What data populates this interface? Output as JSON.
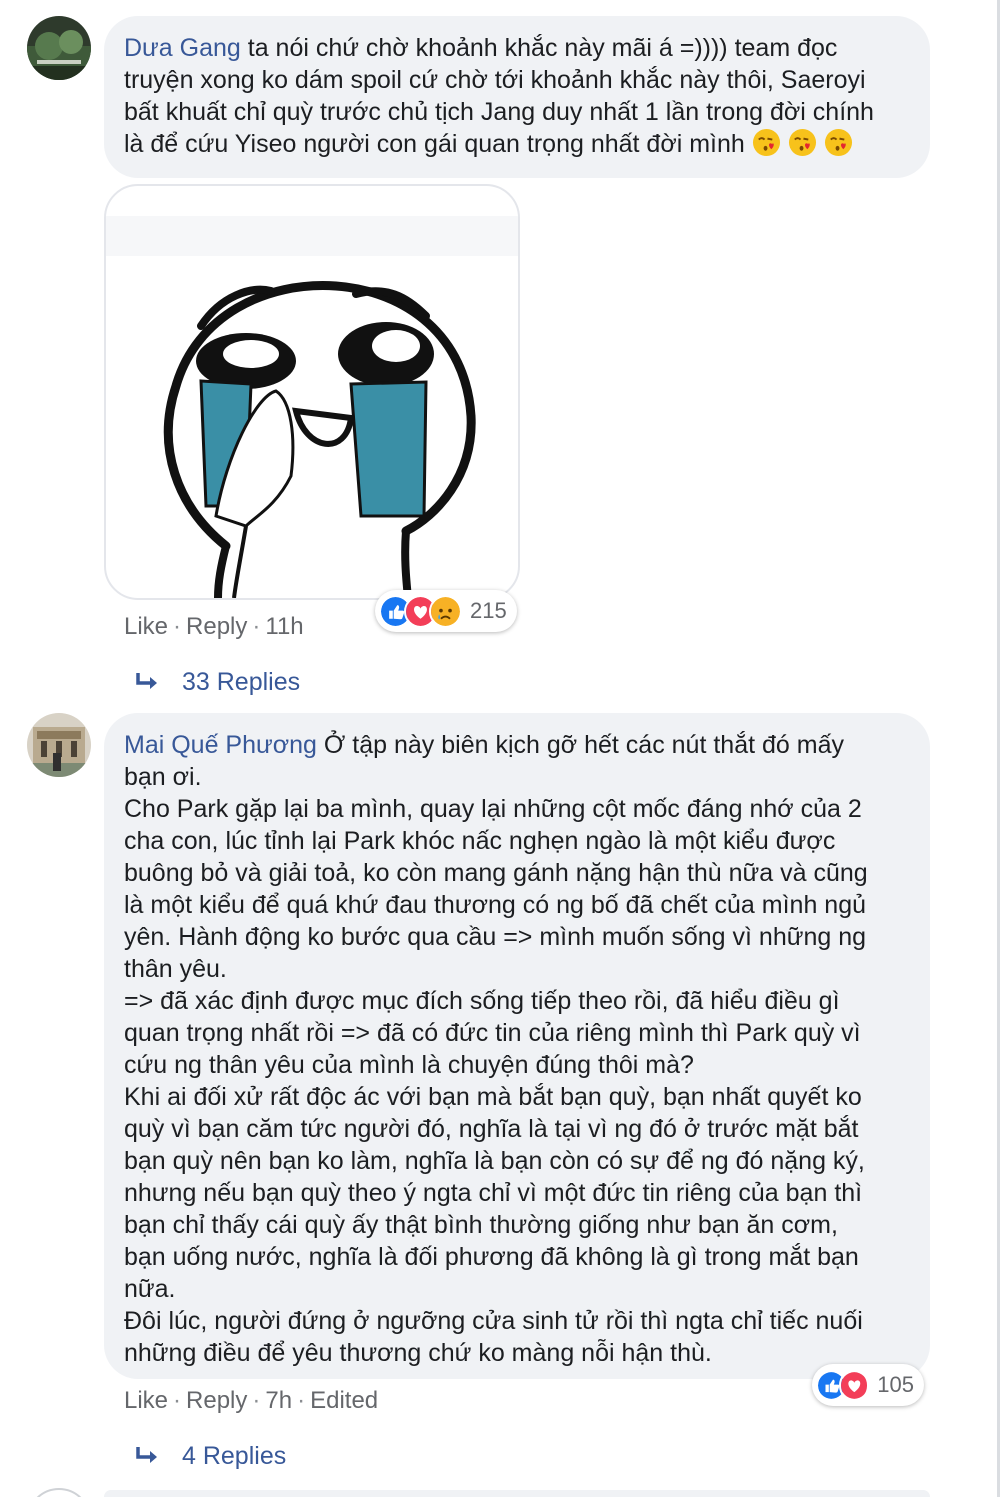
{
  "comments": [
    {
      "author": "Dưa Gang",
      "text": " ta nói chứ chờ khoảnh khắc này mãi á =)))) team đọc\ntruyện xong ko dám spoil cứ chờ tới khoảnh khắc này thôi, Saeroyi\nbất khuất chỉ quỳ trước chủ tịch Jang duy nhất 1 lần trong đời chính\nlà để cứu Yiseo người con gái quan trọng nhất đời mình ",
      "emoji": [
        "kissing-heart",
        "kissing-heart",
        "kissing-heart"
      ],
      "has_sticker": true,
      "like_label": "Like",
      "reply_label": "Reply",
      "time": "11h",
      "reactions": [
        "like",
        "love",
        "sad"
      ],
      "reaction_count": "215",
      "replies_label": "33 Replies"
    },
    {
      "author": "Mai Quế Phương",
      "text": " Ở tập này biên kịch gỡ hết các nút thắt đó mấy\nbạn ơi.\nCho Park gặp lại ba mình, quay lại những cột mốc đáng nhớ của 2\ncha con, lúc tỉnh lại Park khóc nấc nghẹn ngào là một kiểu được\nbuông bỏ và giải toả, ko còn mang gánh nặng hận thù nữa và cũng\nlà một kiểu để quá khứ đau thương có ng bố đã chết của mình ngủ\nyên. Hành động ko bước qua cầu => mình muốn sống vì những ng\nthân yêu.\n=> đã xác định được mục đích sống tiếp theo rồi, đã hiểu điều gì\nquan trọng nhất rồi => đã có đức tin của riêng mình thì Park quỳ vì\ncứu ng thân yêu của mình là chuyện đúng thôi mà?\nKhi ai đối xử rất độc ác với bạn mà bắt bạn quỳ, bạn nhất quyết ko\nquỳ vì bạn căm tức người đó, nghĩa là tại vì ng đó ở trước mặt bắt\nbạn quỳ nên bạn ko làm, nghĩa là bạn còn có sự để ng đó nặng ký,\nnhưng nếu bạn quỳ theo ý ngta chỉ vì một đức tin riêng của bạn thì\nbạn chỉ thấy cái quỳ ấy thật bình thường giống như bạn ăn cơm,\nbạn uống nước, nghĩa là đối phương đã không là gì trong mắt bạn\nnữa.\nĐôi lúc, người đứng ở ngưỡng cửa sinh tử rồi thì ngta chỉ tiếc nuối\nnhững điều để yêu thương chứ ko màng nỗi hận thù.",
      "like_label": "Like",
      "reply_label": "Reply",
      "time": "7h",
      "edited_label": "Edited",
      "reactions": [
        "like",
        "love"
      ],
      "reaction_count": "105",
      "replies_label": "4 Replies"
    }
  ],
  "colors": {
    "name_link": "#385898",
    "bubble_bg": "#f0f2f5",
    "meta_text": "#65676b",
    "like_blue": "#1877f2",
    "love_red": "#f33e58",
    "sad_yellow": "#f7b125"
  }
}
